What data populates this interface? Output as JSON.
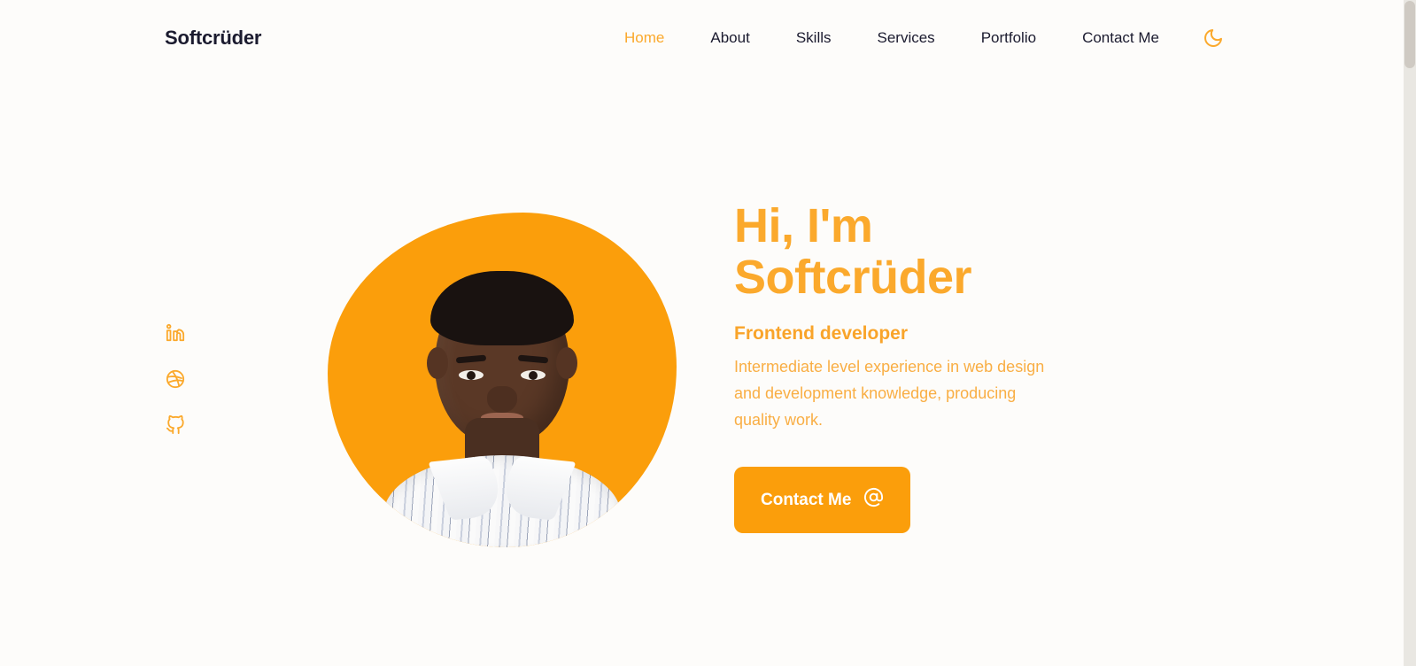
{
  "theme": {
    "background": "#FDFCFA",
    "accent": "#FB9E0B",
    "accent_light": "#FBA92C",
    "text_dark": "#1B1B2F",
    "body_text": "#F9AE44"
  },
  "header": {
    "logo": "Softcrüder",
    "nav": [
      {
        "label": "Home",
        "active": true
      },
      {
        "label": "About",
        "active": false
      },
      {
        "label": "Skills",
        "active": false
      },
      {
        "label": "Services",
        "active": false
      },
      {
        "label": "Portfolio",
        "active": false
      },
      {
        "label": "Contact Me",
        "active": false
      }
    ],
    "theme_toggle_icon": "moon-icon"
  },
  "social_rail": [
    {
      "icon": "linkedin-icon",
      "label": "LinkedIn"
    },
    {
      "icon": "dribbble-icon",
      "label": "Dribbble"
    },
    {
      "icon": "github-icon",
      "label": "GitHub"
    }
  ],
  "hero": {
    "greeting": "Hi, I'm",
    "name": "Softcrüder",
    "role": "Frontend developer",
    "description": "Intermediate level experience in web design and development knowledge, producing quality work.",
    "cta_label": "Contact Me",
    "cta_icon": "at-sign-icon",
    "portrait_alt": "Portrait photo of Softcrüder on an orange blob background"
  },
  "scrollbar": {
    "orientation": "vertical",
    "thumb_position_percent": 0
  }
}
